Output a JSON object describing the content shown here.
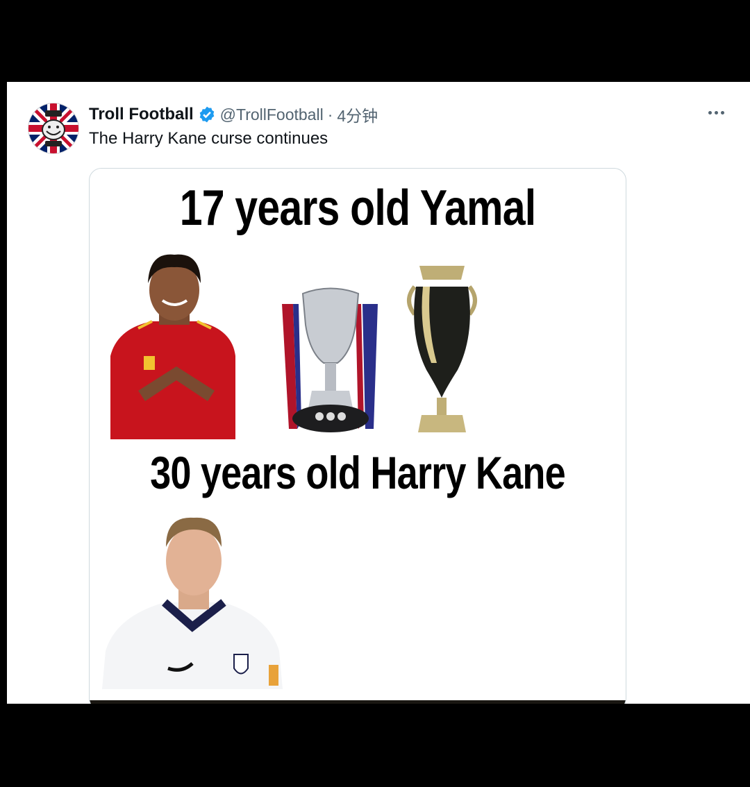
{
  "tweet": {
    "author_name": "Troll Football",
    "handle": "@TrollFootball",
    "separator": "·",
    "time": "4分钟",
    "text": "The Harry Kane curse continues"
  },
  "media": {
    "headline_1": "17 years old Yamal",
    "headline_2": "30 years old Harry Kane"
  },
  "icons": {
    "verified": "verified-badge-icon",
    "more": "more-options-icon"
  },
  "colors": {
    "verified_blue": "#1d9bf0",
    "text_primary": "#0f1419",
    "text_secondary": "#536471"
  }
}
